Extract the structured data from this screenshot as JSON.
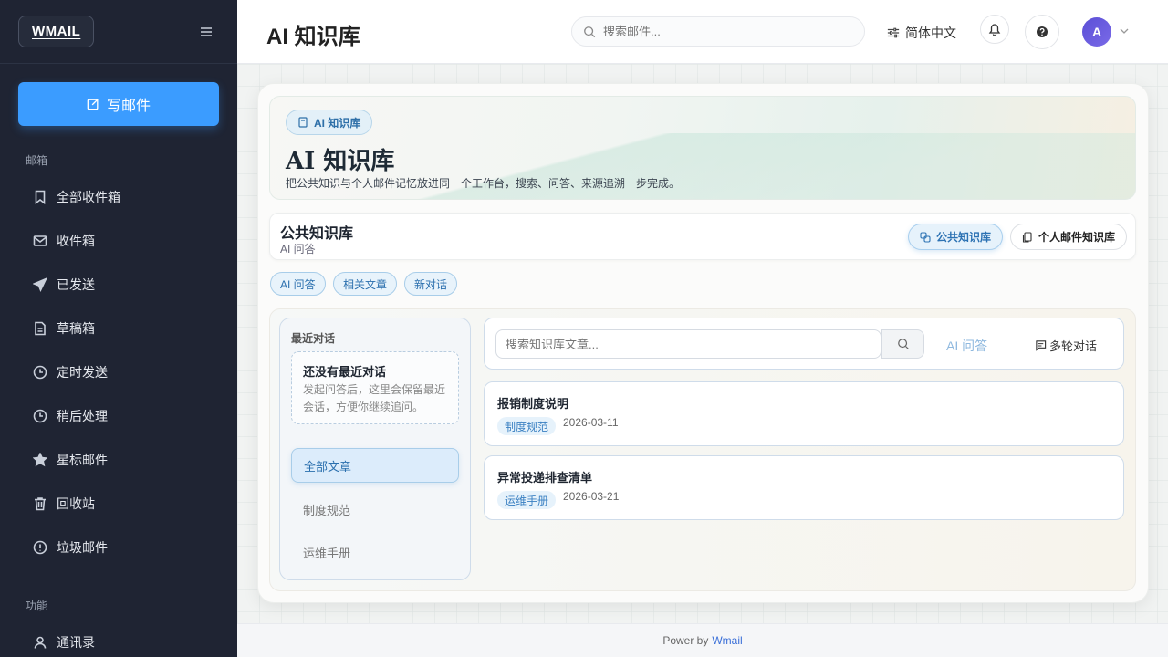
{
  "sidebar": {
    "logo": "WMAIL",
    "compose_label": "写邮件",
    "section_mailbox": "邮箱",
    "section_features": "功能",
    "items": [
      {
        "label": "全部收件箱",
        "icon": "bookmark-icon"
      },
      {
        "label": "收件箱",
        "icon": "mail-icon"
      },
      {
        "label": "已发送",
        "icon": "send-icon"
      },
      {
        "label": "草稿箱",
        "icon": "draft-icon"
      },
      {
        "label": "定时发送",
        "icon": "clock-icon"
      },
      {
        "label": "稍后处理",
        "icon": "clock-icon"
      },
      {
        "label": "星标邮件",
        "icon": "star-icon"
      },
      {
        "label": "回收站",
        "icon": "trash-icon"
      },
      {
        "label": "垃圾邮件",
        "icon": "alert-icon"
      }
    ],
    "feature_items": [
      {
        "label": "通讯录",
        "icon": "user-icon"
      }
    ]
  },
  "header": {
    "title": "AI 知识库",
    "search_placeholder": "搜索邮件...",
    "language": "简体中文",
    "avatar_initial": "A"
  },
  "hero": {
    "badge": "AI 知识库",
    "title": "AI 知识库",
    "description": "把公共知识与个人邮件记忆放进同一个工作台，搜索、问答、来源追溯一步完成。"
  },
  "kb": {
    "title": "公共知识库",
    "subtitle": "AI 问答",
    "public_button": "公共知识库",
    "personal_button": "个人邮件知识库"
  },
  "chips": [
    "AI 问答",
    "相关文章",
    "新对话"
  ],
  "recent": {
    "label": "最近对话",
    "empty_title": "还没有最近对话",
    "empty_desc": "发起问答后，这里会保留最近会话，方便你继续追问。"
  },
  "categories": [
    "全部文章",
    "制度规范",
    "运维手册"
  ],
  "kb_search": {
    "placeholder": "搜索知识库文章...",
    "ai_link": "AI 问答",
    "multi_label": "多轮对话"
  },
  "articles": [
    {
      "title": "报销制度说明",
      "tag": "制度规范",
      "date": "2026-03-11"
    },
    {
      "title": "异常投递排查清单",
      "tag": "运维手册",
      "date": "2026-03-21"
    }
  ],
  "footer": {
    "prefix": "Power by",
    "brand": "Wmail"
  },
  "colors": {
    "sidebar_bg": "#1f2433",
    "accent": "#3b9cff",
    "chip_blue": "#2a6fae"
  }
}
